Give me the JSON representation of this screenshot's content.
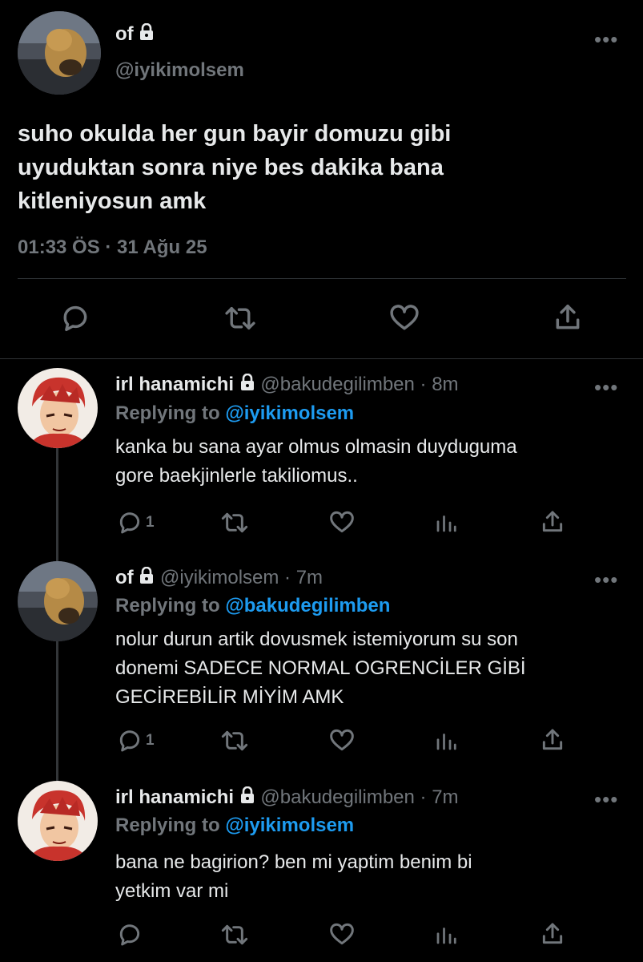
{
  "main_tweet": {
    "display_name": "of",
    "handle": "@iyikimolsem",
    "text_lines": [
      "suho okulda her gun bayir domuzu gibi",
      "uyuduktan sonra niye bes dakika bana",
      "kitleniyosun amk"
    ],
    "timestamp": "01:33 ÖS · 31 Ağu 25"
  },
  "replies": [
    {
      "display_name": "irl hanamichi",
      "handle": "@bakudegilimben",
      "time": " · 8m",
      "replying_label": "Replying to",
      "replying_to": "@iyikimolsem",
      "text_lines": [
        "kanka bu sana ayar olmus olmasin duyduguma",
        "gore baekjinlerle takiliomus.."
      ],
      "reply_count": "1"
    },
    {
      "display_name": "of",
      "handle": "@iyikimolsem",
      "time": " · 7m",
      "replying_label": "Replying to",
      "replying_to": "@bakudegilimben",
      "text_lines": [
        "nolur durun artik dovusmek istemiyorum su son",
        "donemi SADECE NORMAL OGRENCİLER GİBİ",
        "GECİREBİLİR MİYİM AMK"
      ],
      "reply_count": "1"
    },
    {
      "display_name": "irl hanamichi",
      "handle": "@bakudegilimben",
      "time": " · 7m",
      "replying_label": "Replying to",
      "replying_to": "@iyikimolsem",
      "text_lines": [
        "bana ne bagirion? ben mi yaptim benim bi",
        "yetkim var mi"
      ],
      "reply_count": ""
    }
  ],
  "icons": {
    "lock": "lock-icon",
    "more": "more-dots-icon",
    "reply": "reply-icon",
    "retweet": "retweet-icon",
    "like": "heart-icon",
    "share": "share-icon",
    "analytics": "analytics-icon"
  },
  "colors": {
    "background": "#000000",
    "text": "#e7e9ea",
    "muted": "#71767b",
    "link": "#1d9bf0",
    "divider": "#2f3336"
  }
}
